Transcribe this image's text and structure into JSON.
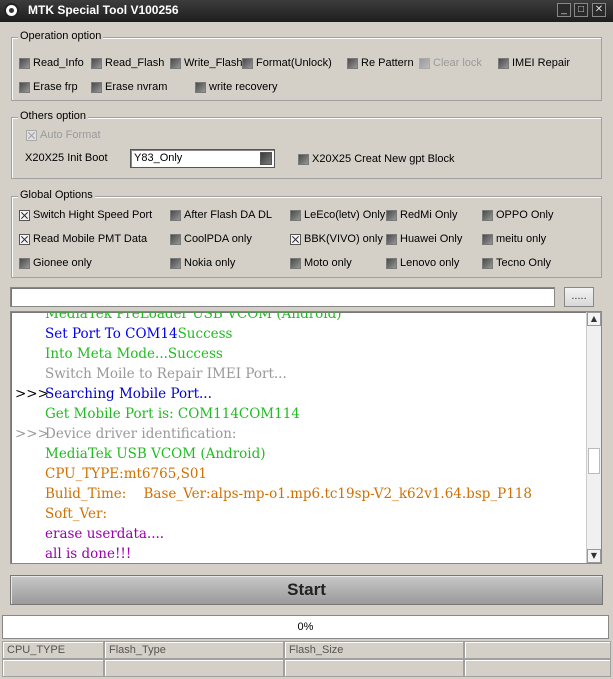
{
  "window": {
    "title": "MTK Special Tool V100256",
    "minimize": "_",
    "maximize": "□",
    "close": "✕"
  },
  "operation": {
    "title": "Operation option",
    "options": [
      {
        "label": "Read_Info",
        "checked": false
      },
      {
        "label": "Read_Flash",
        "checked": false
      },
      {
        "label": "Write_Flash",
        "checked": false
      },
      {
        "label": "Format(Unlock)",
        "checked": false
      },
      {
        "label": "Re Pattern lo",
        "checked": false
      },
      {
        "label": "Clear lock",
        "checked": false,
        "disabled": true
      },
      {
        "label": "IMEI Repair",
        "checked": false
      },
      {
        "label": "Erase frp",
        "checked": false
      },
      {
        "label": "Erase nvram",
        "checked": false
      },
      {
        "label": "write recovery",
        "checked": false
      }
    ]
  },
  "others": {
    "title": "Others option",
    "auto_format": "Auto Format",
    "init_boot_label": "X20X25 Init Boot",
    "init_boot_value": "Y83_Only",
    "creat_gpt": "X20X25 Creat New gpt Block"
  },
  "global": {
    "title": "Global Options",
    "options": [
      {
        "label": "Switch Hight Speed Port",
        "checked": true
      },
      {
        "label": "After Flash DA DL",
        "checked": false
      },
      {
        "label": "LeEco(letv) Only",
        "checked": false
      },
      {
        "label": "RedMi Only",
        "checked": false
      },
      {
        "label": "OPPO Only",
        "checked": false
      },
      {
        "label": "Read Mobile PMT Data",
        "checked": true
      },
      {
        "label": "CoolPDA only",
        "checked": false
      },
      {
        "label": "BBK(VIVO) only",
        "checked": true
      },
      {
        "label": "Huawei Only",
        "checked": false
      },
      {
        "label": "meitu only",
        "checked": false
      },
      {
        "label": "Gionee only",
        "checked": false
      },
      {
        "label": "Nokia only",
        "checked": false
      },
      {
        "label": "Moto only",
        "checked": false
      },
      {
        "label": "Lenovo only",
        "checked": false
      },
      {
        "label": "Tecno Only",
        "checked": false
      }
    ]
  },
  "path": {
    "value": "",
    "browse": "....."
  },
  "log": {
    "lines": [
      {
        "prefix": "",
        "text": "MediaTek PreLoader USB VCOM (Android)",
        "color": "#22bb22"
      },
      {
        "prefix": "",
        "text": "Set Port To COM14",
        "suffix": "Success",
        "color": "#0000ee",
        "suffix_color": "#22bb22"
      },
      {
        "prefix": "",
        "text": "Into Meta Mode...Success",
        "color": "#22bb22"
      },
      {
        "prefix": "",
        "text": "Switch Moile to Repair IMEI Port...",
        "color": "#999999"
      },
      {
        "prefix": ">>>",
        "text": "Searching Mobile Port...",
        "color": "#0000cc"
      },
      {
        "prefix": "",
        "text": "Get Mobile Port is: COM114COM114",
        "color": "#22bb22"
      },
      {
        "prefix": ">>>",
        "text": "Device driver identification:",
        "color": "#999999"
      },
      {
        "prefix": "",
        "text": "MediaTek USB VCOM (Android)",
        "color": "#22bb22"
      },
      {
        "prefix": "",
        "text": "CPU_TYPE:mt6765,S01",
        "color": "#d07000"
      },
      {
        "prefix": "",
        "text": "Bulid_Time:    Base_Ver:alps-mp-o1.mp6.tc19sp-V2_k62v1.64.bsp_P118",
        "color": "#d07000"
      },
      {
        "prefix": "",
        "text": "Soft_Ver:",
        "color": "#d07000"
      },
      {
        "prefix": "",
        "text": "erase userdata....",
        "color": "#9900aa"
      },
      {
        "prefix": "",
        "text": "all is done!!!",
        "color": "#9900aa"
      }
    ]
  },
  "start_label": "Start",
  "progress": {
    "percent": 0,
    "label": "0%"
  },
  "status": {
    "cpu_type": "CPU_TYPE",
    "flash_type": "Flash_Type",
    "flash_size": "Flash_Size",
    "cell4": "",
    "cell5": "",
    "cell6": "",
    "cell7": "",
    "cell8": ""
  }
}
